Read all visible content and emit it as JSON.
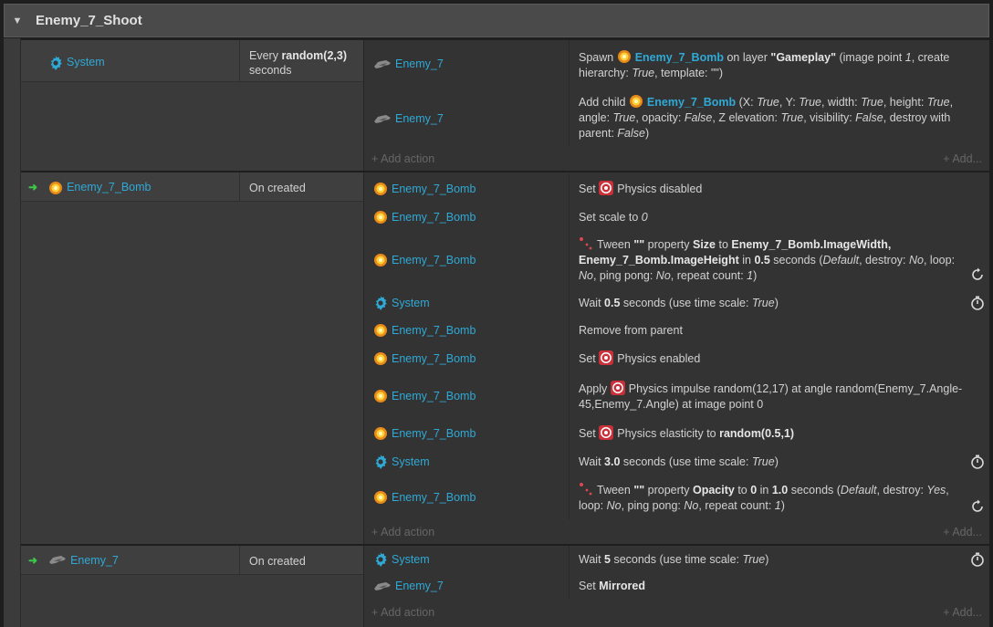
{
  "group": {
    "title": "Enemy_7_Shoot"
  },
  "events": [
    {
      "conditions": [
        {
          "object": "System",
          "icon": "gear-icon",
          "text_pre": "Every ",
          "text_bold": "random(2,3)",
          "text_post": " seconds"
        }
      ],
      "actions": [
        {
          "object": "Enemy_7",
          "icon": "enemy-7-sprite-icon",
          "parts": [
            "Spawn ",
            "Enemy_7_Bomb",
            " on layer ",
            "\"Gameplay\"",
            " (image point ",
            "1",
            ", create hierarchy: ",
            "True",
            ", template: \"\")"
          ]
        },
        {
          "object": "Enemy_7",
          "icon": "enemy-7-sprite-icon",
          "parts": [
            "Add child ",
            "Enemy_7_Bomb",
            " (X: ",
            "True",
            ", Y: ",
            "True",
            ", width: ",
            "True",
            ", height: ",
            "True",
            ", angle: ",
            "True",
            ", opacity: ",
            "False",
            ", Z elevation: ",
            "True",
            ", visibility: ",
            "False",
            ", destroy with parent: ",
            "False",
            ")"
          ]
        }
      ],
      "add_action": "+ Add action",
      "add_dots": "+ Add..."
    },
    {
      "conditions": [
        {
          "object": "Enemy_7_Bomb",
          "icon": "bomb-sprite-icon",
          "text": "On created"
        }
      ],
      "actions": [
        {
          "object": "Enemy_7_Bomb",
          "parts": [
            "Set ",
            "Physics disabled"
          ]
        },
        {
          "object": "Enemy_7_Bomb",
          "parts": [
            "Set scale to ",
            "0"
          ]
        },
        {
          "object": "Enemy_7_Bomb",
          "parts": [
            "Tween ",
            "\"\"",
            " property ",
            "Size",
            " to ",
            "Enemy_7_Bomb.ImageWidth, Enemy_7_Bomb.ImageHeight",
            " in ",
            "0.5",
            " seconds (",
            "Default",
            ", destroy: ",
            "No",
            ", loop: ",
            "No",
            ", ping pong: ",
            "No",
            ", repeat count: ",
            "1",
            ")"
          ]
        },
        {
          "object": "System",
          "parts": [
            "Wait ",
            "0.5",
            " seconds (use time scale: ",
            "True",
            ")"
          ]
        },
        {
          "object": "Enemy_7_Bomb",
          "parts": [
            "Remove from parent"
          ]
        },
        {
          "object": "Enemy_7_Bomb",
          "parts": [
            "Set ",
            "Physics enabled"
          ]
        },
        {
          "object": "Enemy_7_Bomb",
          "parts": [
            "Apply ",
            "Physics impulse random(12,17) at angle random(Enemy_7.Angle-45,Enemy_7.Angle) at image point 0"
          ]
        },
        {
          "object": "Enemy_7_Bomb",
          "parts": [
            "Set ",
            "Physics elasticity to ",
            "random(0.5,1)"
          ]
        },
        {
          "object": "System",
          "parts": [
            "Wait ",
            "3.0",
            " seconds (use time scale: ",
            "True",
            ")"
          ]
        },
        {
          "object": "Enemy_7_Bomb",
          "parts": [
            "Tween ",
            "\"\"",
            " property ",
            "Opacity",
            " to ",
            "0",
            " in ",
            "1.0",
            " seconds (",
            "Default",
            ", destroy: ",
            "Yes",
            ", loop: ",
            "No",
            ", ping pong: ",
            "No",
            ", repeat count: ",
            "1",
            ")"
          ]
        }
      ],
      "add_action": "+ Add action",
      "add_dots": "+ Add..."
    },
    {
      "conditions": [
        {
          "object": "Enemy_7",
          "icon": "enemy-7-sprite-icon",
          "text": "On created"
        }
      ],
      "actions": [
        {
          "object": "System",
          "parts": [
            "Wait ",
            "5",
            " seconds (use time scale: ",
            "True",
            ")"
          ]
        },
        {
          "object": "Enemy_7",
          "parts": [
            "Set ",
            "Mirrored"
          ]
        }
      ],
      "add_action": "+ Add action",
      "add_dots": "+ Add..."
    }
  ],
  "colors": {
    "link": "#2fa9d6",
    "trigger_arrow": "#3ec84a",
    "physics_icon": "#e0464f"
  }
}
